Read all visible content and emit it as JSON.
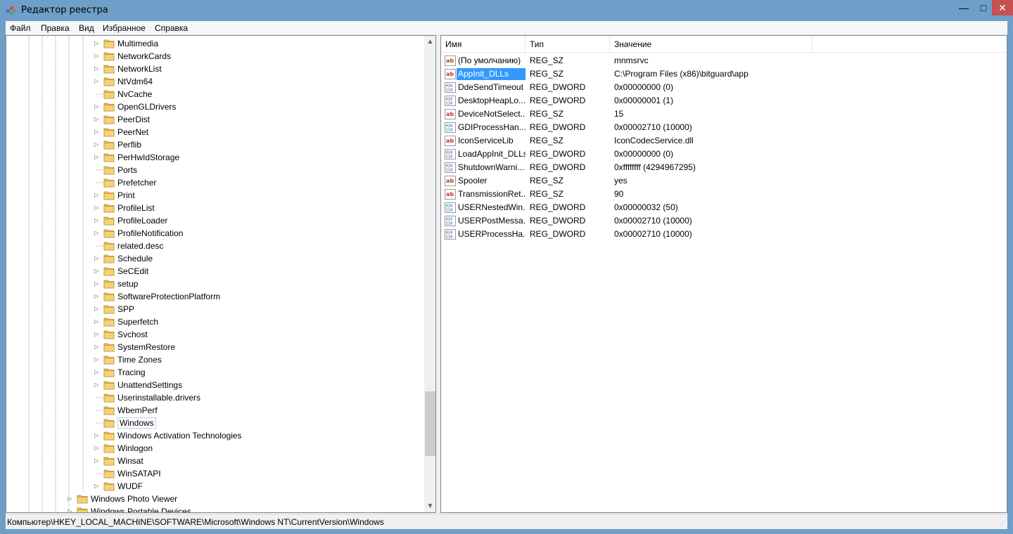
{
  "window": {
    "title": "Редактор реестра",
    "controls": {
      "minimize": "—",
      "maximize": "□",
      "close": "✕"
    }
  },
  "menu": [
    "Файл",
    "Правка",
    "Вид",
    "Избранное",
    "Справка"
  ],
  "tree": {
    "items": [
      {
        "label": "Multimedia",
        "expandable": true
      },
      {
        "label": "NetworkCards",
        "expandable": true
      },
      {
        "label": "NetworkList",
        "expandable": true
      },
      {
        "label": "NtVdm64",
        "expandable": true
      },
      {
        "label": "NvCache",
        "expandable": false
      },
      {
        "label": "OpenGLDrivers",
        "expandable": true
      },
      {
        "label": "PeerDist",
        "expandable": true
      },
      {
        "label": "PeerNet",
        "expandable": true
      },
      {
        "label": "Perflib",
        "expandable": true
      },
      {
        "label": "PerHwIdStorage",
        "expandable": true
      },
      {
        "label": "Ports",
        "expandable": false
      },
      {
        "label": "Prefetcher",
        "expandable": false
      },
      {
        "label": "Print",
        "expandable": true
      },
      {
        "label": "ProfileList",
        "expandable": true
      },
      {
        "label": "ProfileLoader",
        "expandable": true
      },
      {
        "label": "ProfileNotification",
        "expandable": true
      },
      {
        "label": "related.desc",
        "expandable": false
      },
      {
        "label": "Schedule",
        "expandable": true
      },
      {
        "label": "SeCEdit",
        "expandable": true
      },
      {
        "label": "setup",
        "expandable": true
      },
      {
        "label": "SoftwareProtectionPlatform",
        "expandable": true
      },
      {
        "label": "SPP",
        "expandable": true
      },
      {
        "label": "Superfetch",
        "expandable": true
      },
      {
        "label": "Svchost",
        "expandable": true
      },
      {
        "label": "SystemRestore",
        "expandable": true
      },
      {
        "label": "Time Zones",
        "expandable": true
      },
      {
        "label": "Tracing",
        "expandable": true
      },
      {
        "label": "UnattendSettings",
        "expandable": true
      },
      {
        "label": "Userinstallable.drivers",
        "expandable": false
      },
      {
        "label": "WbemPerf",
        "expandable": false
      },
      {
        "label": "Windows",
        "expandable": false,
        "selected": true
      },
      {
        "label": "Windows Activation Technologies",
        "expandable": true
      },
      {
        "label": "Winlogon",
        "expandable": true
      },
      {
        "label": "Winsat",
        "expandable": true
      },
      {
        "label": "WinSATAPI",
        "expandable": false
      },
      {
        "label": "WUDF",
        "expandable": true
      }
    ],
    "parent_items": [
      {
        "label": "Windows Photo Viewer",
        "expandable": true
      },
      {
        "label": "Windows Portable Devices",
        "expandable": true
      }
    ]
  },
  "list": {
    "columns": [
      "Имя",
      "Тип",
      "Значение"
    ],
    "rows": [
      {
        "icon": "string-value-icon",
        "name": "(По умолчанию)",
        "type": "REG_SZ",
        "value": "mnmsrvc"
      },
      {
        "icon": "string-value-icon",
        "name": "AppInit_DLLs",
        "type": "REG_SZ",
        "value": "C:\\Program Files (x86)\\bitguard\\app",
        "selected": true
      },
      {
        "icon": "binary-value-icon",
        "name": "DdeSendTimeout",
        "type": "REG_DWORD",
        "value": "0x00000000 (0)"
      },
      {
        "icon": "binary-value-icon",
        "name": "DesktopHeapLo...",
        "type": "REG_DWORD",
        "value": "0x00000001 (1)"
      },
      {
        "icon": "string-value-icon",
        "name": "DeviceNotSelect...",
        "type": "REG_SZ",
        "value": "15"
      },
      {
        "icon": "binary-value-icon",
        "name": "GDIProcessHan...",
        "type": "REG_DWORD",
        "value": "0x00002710 (10000)"
      },
      {
        "icon": "string-value-icon",
        "name": "IconServiceLib",
        "type": "REG_SZ",
        "value": "IconCodecService.dll"
      },
      {
        "icon": "binary-value-icon",
        "name": "LoadAppInit_DLLs",
        "type": "REG_DWORD",
        "value": "0x00000000 (0)"
      },
      {
        "icon": "binary-value-icon",
        "name": "ShutdownWarni...",
        "type": "REG_DWORD",
        "value": "0xffffffff (4294967295)"
      },
      {
        "icon": "string-value-icon",
        "name": "Spooler",
        "type": "REG_SZ",
        "value": "yes"
      },
      {
        "icon": "string-value-icon",
        "name": "TransmissionRet...",
        "type": "REG_SZ",
        "value": "90"
      },
      {
        "icon": "binary-value-icon",
        "name": "USERNestedWin...",
        "type": "REG_DWORD",
        "value": "0x00000032 (50)"
      },
      {
        "icon": "binary-value-icon",
        "name": "USERPostMessa...",
        "type": "REG_DWORD",
        "value": "0x00002710 (10000)"
      },
      {
        "icon": "binary-value-icon",
        "name": "USERProcessHa...",
        "type": "REG_DWORD",
        "value": "0x00002710 (10000)"
      }
    ]
  },
  "status": {
    "path": "Компьютер\\HKEY_LOCAL_MACHINE\\SOFTWARE\\Microsoft\\Windows NT\\CurrentVersion\\Windows"
  },
  "colors": {
    "frame": "#6d9fc9",
    "selection": "#3399ff",
    "folder": "#e8c15a",
    "close_button": "#c75050"
  }
}
